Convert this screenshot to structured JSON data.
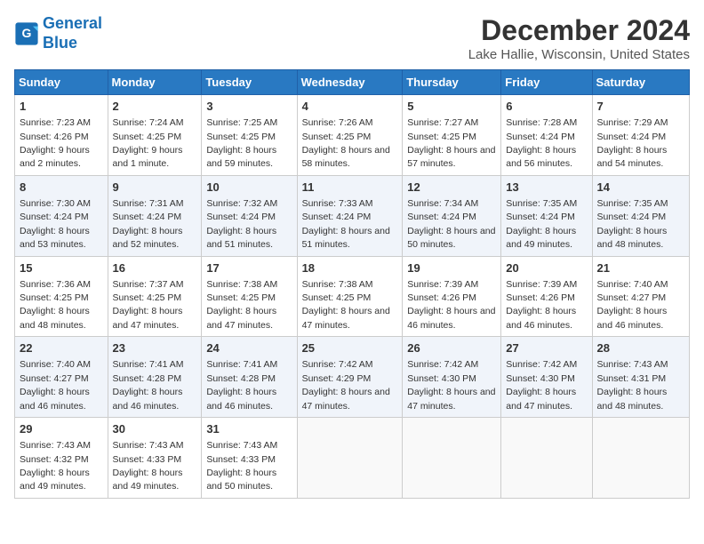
{
  "logo": {
    "line1": "General",
    "line2": "Blue"
  },
  "title": "December 2024",
  "subtitle": "Lake Hallie, Wisconsin, United States",
  "days_of_week": [
    "Sunday",
    "Monday",
    "Tuesday",
    "Wednesday",
    "Thursday",
    "Friday",
    "Saturday"
  ],
  "weeks": [
    [
      {
        "day": 1,
        "sunrise": "Sunrise: 7:23 AM",
        "sunset": "Sunset: 4:26 PM",
        "daylight": "Daylight: 9 hours and 2 minutes."
      },
      {
        "day": 2,
        "sunrise": "Sunrise: 7:24 AM",
        "sunset": "Sunset: 4:25 PM",
        "daylight": "Daylight: 9 hours and 1 minute."
      },
      {
        "day": 3,
        "sunrise": "Sunrise: 7:25 AM",
        "sunset": "Sunset: 4:25 PM",
        "daylight": "Daylight: 8 hours and 59 minutes."
      },
      {
        "day": 4,
        "sunrise": "Sunrise: 7:26 AM",
        "sunset": "Sunset: 4:25 PM",
        "daylight": "Daylight: 8 hours and 58 minutes."
      },
      {
        "day": 5,
        "sunrise": "Sunrise: 7:27 AM",
        "sunset": "Sunset: 4:25 PM",
        "daylight": "Daylight: 8 hours and 57 minutes."
      },
      {
        "day": 6,
        "sunrise": "Sunrise: 7:28 AM",
        "sunset": "Sunset: 4:24 PM",
        "daylight": "Daylight: 8 hours and 56 minutes."
      },
      {
        "day": 7,
        "sunrise": "Sunrise: 7:29 AM",
        "sunset": "Sunset: 4:24 PM",
        "daylight": "Daylight: 8 hours and 54 minutes."
      }
    ],
    [
      {
        "day": 8,
        "sunrise": "Sunrise: 7:30 AM",
        "sunset": "Sunset: 4:24 PM",
        "daylight": "Daylight: 8 hours and 53 minutes."
      },
      {
        "day": 9,
        "sunrise": "Sunrise: 7:31 AM",
        "sunset": "Sunset: 4:24 PM",
        "daylight": "Daylight: 8 hours and 52 minutes."
      },
      {
        "day": 10,
        "sunrise": "Sunrise: 7:32 AM",
        "sunset": "Sunset: 4:24 PM",
        "daylight": "Daylight: 8 hours and 51 minutes."
      },
      {
        "day": 11,
        "sunrise": "Sunrise: 7:33 AM",
        "sunset": "Sunset: 4:24 PM",
        "daylight": "Daylight: 8 hours and 51 minutes."
      },
      {
        "day": 12,
        "sunrise": "Sunrise: 7:34 AM",
        "sunset": "Sunset: 4:24 PM",
        "daylight": "Daylight: 8 hours and 50 minutes."
      },
      {
        "day": 13,
        "sunrise": "Sunrise: 7:35 AM",
        "sunset": "Sunset: 4:24 PM",
        "daylight": "Daylight: 8 hours and 49 minutes."
      },
      {
        "day": 14,
        "sunrise": "Sunrise: 7:35 AM",
        "sunset": "Sunset: 4:24 PM",
        "daylight": "Daylight: 8 hours and 48 minutes."
      }
    ],
    [
      {
        "day": 15,
        "sunrise": "Sunrise: 7:36 AM",
        "sunset": "Sunset: 4:25 PM",
        "daylight": "Daylight: 8 hours and 48 minutes."
      },
      {
        "day": 16,
        "sunrise": "Sunrise: 7:37 AM",
        "sunset": "Sunset: 4:25 PM",
        "daylight": "Daylight: 8 hours and 47 minutes."
      },
      {
        "day": 17,
        "sunrise": "Sunrise: 7:38 AM",
        "sunset": "Sunset: 4:25 PM",
        "daylight": "Daylight: 8 hours and 47 minutes."
      },
      {
        "day": 18,
        "sunrise": "Sunrise: 7:38 AM",
        "sunset": "Sunset: 4:25 PM",
        "daylight": "Daylight: 8 hours and 47 minutes."
      },
      {
        "day": 19,
        "sunrise": "Sunrise: 7:39 AM",
        "sunset": "Sunset: 4:26 PM",
        "daylight": "Daylight: 8 hours and 46 minutes."
      },
      {
        "day": 20,
        "sunrise": "Sunrise: 7:39 AM",
        "sunset": "Sunset: 4:26 PM",
        "daylight": "Daylight: 8 hours and 46 minutes."
      },
      {
        "day": 21,
        "sunrise": "Sunrise: 7:40 AM",
        "sunset": "Sunset: 4:27 PM",
        "daylight": "Daylight: 8 hours and 46 minutes."
      }
    ],
    [
      {
        "day": 22,
        "sunrise": "Sunrise: 7:40 AM",
        "sunset": "Sunset: 4:27 PM",
        "daylight": "Daylight: 8 hours and 46 minutes."
      },
      {
        "day": 23,
        "sunrise": "Sunrise: 7:41 AM",
        "sunset": "Sunset: 4:28 PM",
        "daylight": "Daylight: 8 hours and 46 minutes."
      },
      {
        "day": 24,
        "sunrise": "Sunrise: 7:41 AM",
        "sunset": "Sunset: 4:28 PM",
        "daylight": "Daylight: 8 hours and 46 minutes."
      },
      {
        "day": 25,
        "sunrise": "Sunrise: 7:42 AM",
        "sunset": "Sunset: 4:29 PM",
        "daylight": "Daylight: 8 hours and 47 minutes."
      },
      {
        "day": 26,
        "sunrise": "Sunrise: 7:42 AM",
        "sunset": "Sunset: 4:30 PM",
        "daylight": "Daylight: 8 hours and 47 minutes."
      },
      {
        "day": 27,
        "sunrise": "Sunrise: 7:42 AM",
        "sunset": "Sunset: 4:30 PM",
        "daylight": "Daylight: 8 hours and 47 minutes."
      },
      {
        "day": 28,
        "sunrise": "Sunrise: 7:43 AM",
        "sunset": "Sunset: 4:31 PM",
        "daylight": "Daylight: 8 hours and 48 minutes."
      }
    ],
    [
      {
        "day": 29,
        "sunrise": "Sunrise: 7:43 AM",
        "sunset": "Sunset: 4:32 PM",
        "daylight": "Daylight: 8 hours and 49 minutes."
      },
      {
        "day": 30,
        "sunrise": "Sunrise: 7:43 AM",
        "sunset": "Sunset: 4:33 PM",
        "daylight": "Daylight: 8 hours and 49 minutes."
      },
      {
        "day": 31,
        "sunrise": "Sunrise: 7:43 AM",
        "sunset": "Sunset: 4:33 PM",
        "daylight": "Daylight: 8 hours and 50 minutes."
      },
      null,
      null,
      null,
      null
    ]
  ]
}
